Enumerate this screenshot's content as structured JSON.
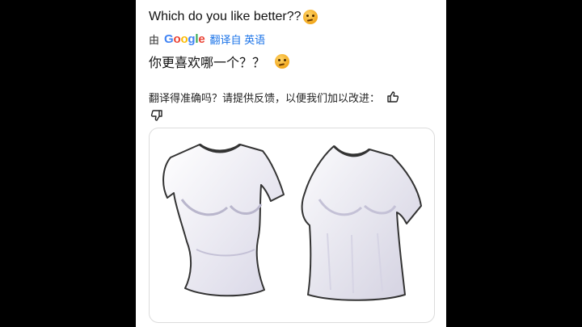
{
  "post": {
    "text": "Which do you like better??",
    "emoji_icon": "thinking-face-icon"
  },
  "translation": {
    "by_label": "由",
    "provider": "Google",
    "action_label": "翻译自 英语",
    "text": "你更喜欢哪一个？？",
    "emoji_icon": "thinking-face-icon"
  },
  "feedback": {
    "prompt": "翻译得准确吗？请提供反馈，以便我们加以改进：",
    "thumbs_up_icon": "thumbs-up-icon",
    "thumbs_down_icon": "thumbs-down-icon"
  },
  "image": {
    "left_item": "fitted-tshirt",
    "right_item": "loose-tshirt"
  }
}
